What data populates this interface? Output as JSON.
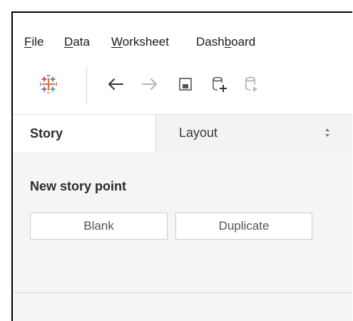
{
  "menu": {
    "file": "File",
    "data": "Data",
    "worksheet": "Worksheet",
    "dashboard": "Dashboard"
  },
  "toolbar": {
    "icons": [
      "tableau-logo-icon",
      "back-arrow-icon",
      "forward-arrow-icon",
      "save-icon",
      "new-data-source-icon",
      "pause-auto-updates-icon"
    ]
  },
  "tabs": {
    "story": "Story",
    "layout": "Layout"
  },
  "story": {
    "section_title": "New story point",
    "blank_button": "Blank",
    "duplicate_button": "Duplicate"
  },
  "colors": {
    "logo_blue": "#1f77b4",
    "logo_orange": "#e8762d",
    "logo_red": "#c72e29",
    "logo_purple": "#5b4ea0"
  }
}
